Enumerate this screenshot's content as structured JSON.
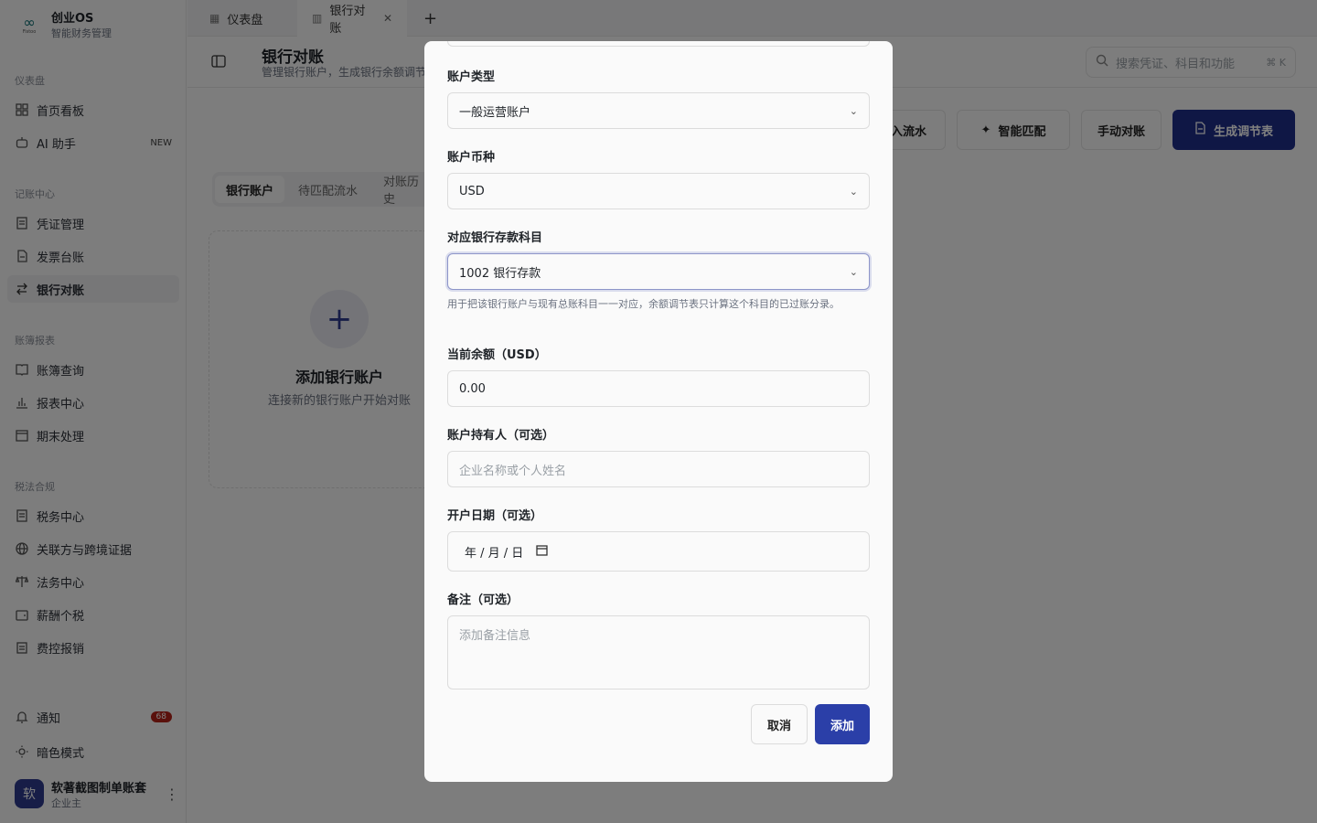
{
  "app": {
    "name": "创业OS",
    "subtitle": "智能财务管理",
    "logo_small": "Fistoo"
  },
  "sidebar": {
    "groups": {
      "dashboard": "仪表盘",
      "bookkeeping": "记账中心",
      "reports": "账簿报表",
      "tax": "税法合规"
    },
    "items": {
      "home": "首页看板",
      "ai": "AI 助手",
      "ai_tag": "NEW",
      "voucher": "凭证管理",
      "invoice": "发票台账",
      "bank": "银行对账",
      "ledger": "账簿查询",
      "report": "报表中心",
      "period": "期末处理",
      "taxcenter": "税务中心",
      "related": "关联方与跨境证据",
      "legal": "法务中心",
      "salary": "薪酬个税",
      "expense": "费控报销"
    },
    "notify": "通知",
    "notify_count": "68",
    "dark_mode": "暗色模式",
    "user": {
      "avatar": "软",
      "name": "软著截图制单账套",
      "role": "企业主"
    }
  },
  "window_tabs": [
    {
      "label": "仪表盘"
    },
    {
      "label": "银行对账"
    }
  ],
  "header": {
    "title": "银行对账",
    "subtitle": "管理银行账户，生成银行余额调节表",
    "search_placeholder": "搜索凭证、科目和功能",
    "search_shortcut": "⌘ K"
  },
  "actions": {
    "import": "导入流水",
    "smart_match": "智能匹配",
    "manual": "手动对账",
    "generate": "生成调节表"
  },
  "page_tabs": [
    "银行账户",
    "待匹配流水",
    "对账历史"
  ],
  "empty_card": {
    "title": "添加银行账户",
    "subtitle": "连接新的银行账户开始对账"
  },
  "modal": {
    "account_type": {
      "label": "账户类型",
      "value": "一般运营账户"
    },
    "currency": {
      "label": "账户币种",
      "value": "USD"
    },
    "subject": {
      "label": "对应银行存款科目",
      "value": "1002 银行存款",
      "hint": "用于把该银行账户与现有总账科目一一对应，余额调节表只计算这个科目的已过账分录。"
    },
    "balance": {
      "label": "当前余额（USD）",
      "value": "0.00"
    },
    "holder": {
      "label": "账户持有人（可选）",
      "placeholder": "企业名称或个人姓名"
    },
    "open_date": {
      "label": "开户日期（可选）",
      "value": "年 / 月 / 日"
    },
    "notes": {
      "label": "备注（可选）",
      "placeholder": "添加备注信息"
    },
    "cancel": "取消",
    "submit": "添加"
  },
  "colors": {
    "primary": "#1f2e8a",
    "badge": "#b42318",
    "overlay": "rgba(0,0,0,0.5)"
  }
}
